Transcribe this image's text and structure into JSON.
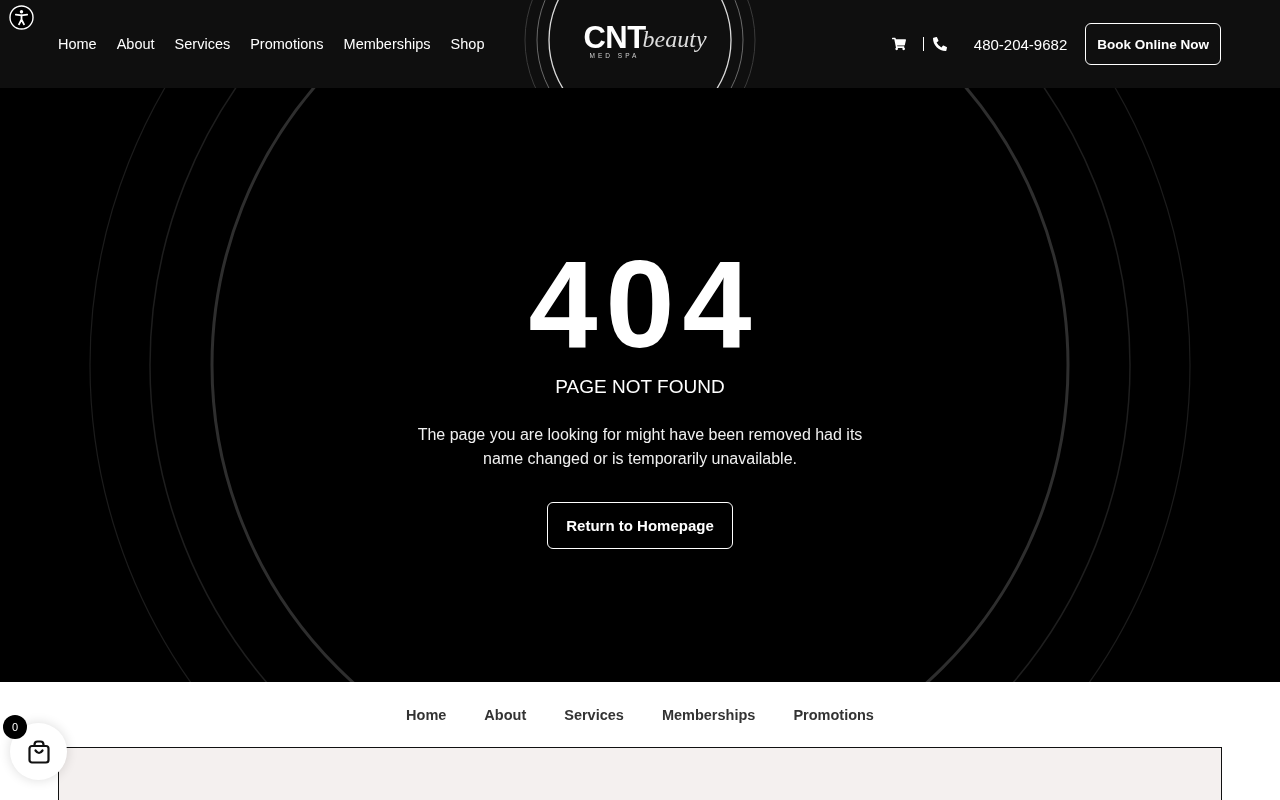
{
  "header": {
    "nav": [
      "Home",
      "About",
      "Services",
      "Promotions",
      "Memberships",
      "Shop"
    ],
    "logo": {
      "wordmark": "CNT",
      "script": "beauty",
      "tagline": "MED SPA"
    },
    "phone": "480-204-9682",
    "cta": "Book Online Now"
  },
  "hero": {
    "code": "404",
    "title": "PAGE NOT FOUND",
    "message": "The page you are looking for might have been removed had its name changed or is temporarily unavailable.",
    "button": "Return to Homepage"
  },
  "footer_nav": [
    "Home",
    "About",
    "Services",
    "Memberships",
    "Promotions"
  ],
  "cart_widget": {
    "count": "0"
  }
}
